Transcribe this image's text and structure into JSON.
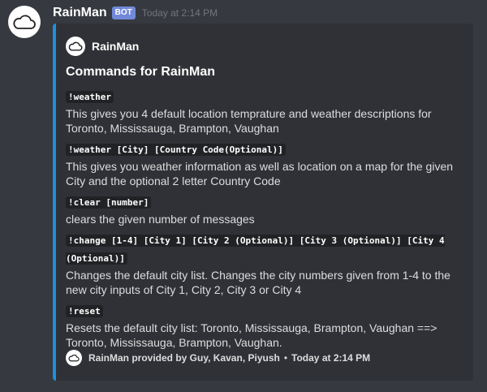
{
  "message": {
    "author": "RainMan",
    "bot_tag": "BOT",
    "timestamp": "Today at 2:14 PM",
    "avatar_icon": "cloud-icon"
  },
  "embed": {
    "accent_color": "#1e90e0",
    "author_name": "RainMan",
    "title": "Commands for RainMan",
    "fields": [
      {
        "name": "!weather",
        "value": "This gives you 4 default location temprature and weather descriptions for Toronto, Mississauga, Brampton, Vaughan"
      },
      {
        "name": "!weather [City] [Country Code(Optional)]",
        "value": "This gives you weather information as well as location on a map for the given City and the optional 2 letter Country Code"
      },
      {
        "name": "!clear [number]",
        "value": "clears the given number of messages"
      },
      {
        "name": "!change [1-4] [City 1] [City 2 (Optional)] [City 3 (Optional)] [City 4 (Optional)]",
        "value": "Changes the default city list. Changes the city numbers given from 1-4 to the new city inputs of City 1, City 2, City 3 or City 4"
      },
      {
        "name": "!reset",
        "value": "Resets the default city list: Toronto, Mississauga, Brampton, Vaughan ==> Toronto, Mississauga, Brampton, Vaughan."
      }
    ],
    "footer": {
      "text": "RainMan provided by Guy, Kavan, Piyush",
      "separator": "•",
      "timestamp": "Today at 2:14 PM"
    }
  }
}
